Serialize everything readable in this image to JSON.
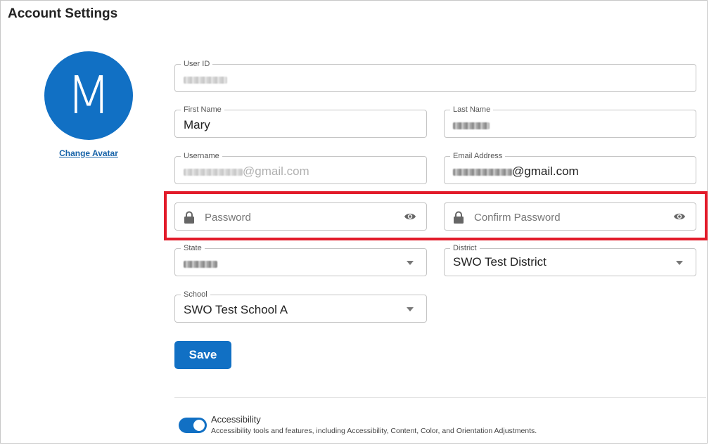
{
  "page": {
    "title": "Account Settings"
  },
  "avatar": {
    "initial": "M",
    "change_label": "Change Avatar"
  },
  "form": {
    "user_id": {
      "label": "User ID",
      "value": ""
    },
    "first_name": {
      "label": "First Name",
      "value": "Mary"
    },
    "last_name": {
      "label": "Last Name",
      "value": ""
    },
    "username": {
      "label": "Username",
      "value_suffix": "@gmail.com"
    },
    "email": {
      "label": "Email Address",
      "value_suffix": "@gmail.com"
    },
    "password": {
      "placeholder": "Password"
    },
    "confirm_password": {
      "placeholder": "Confirm Password"
    },
    "state": {
      "label": "State",
      "value": ""
    },
    "district": {
      "label": "District",
      "value": "SWO Test District"
    },
    "school": {
      "label": "School",
      "value": "SWO Test School A"
    }
  },
  "actions": {
    "save_label": "Save"
  },
  "accessibility": {
    "title": "Accessibility",
    "description": "Accessibility tools and features, including Accessibility, Content, Color, and Orientation Adjustments.",
    "enabled": true
  },
  "colors": {
    "accent": "#1170c4",
    "highlight": "#e21b2a"
  }
}
